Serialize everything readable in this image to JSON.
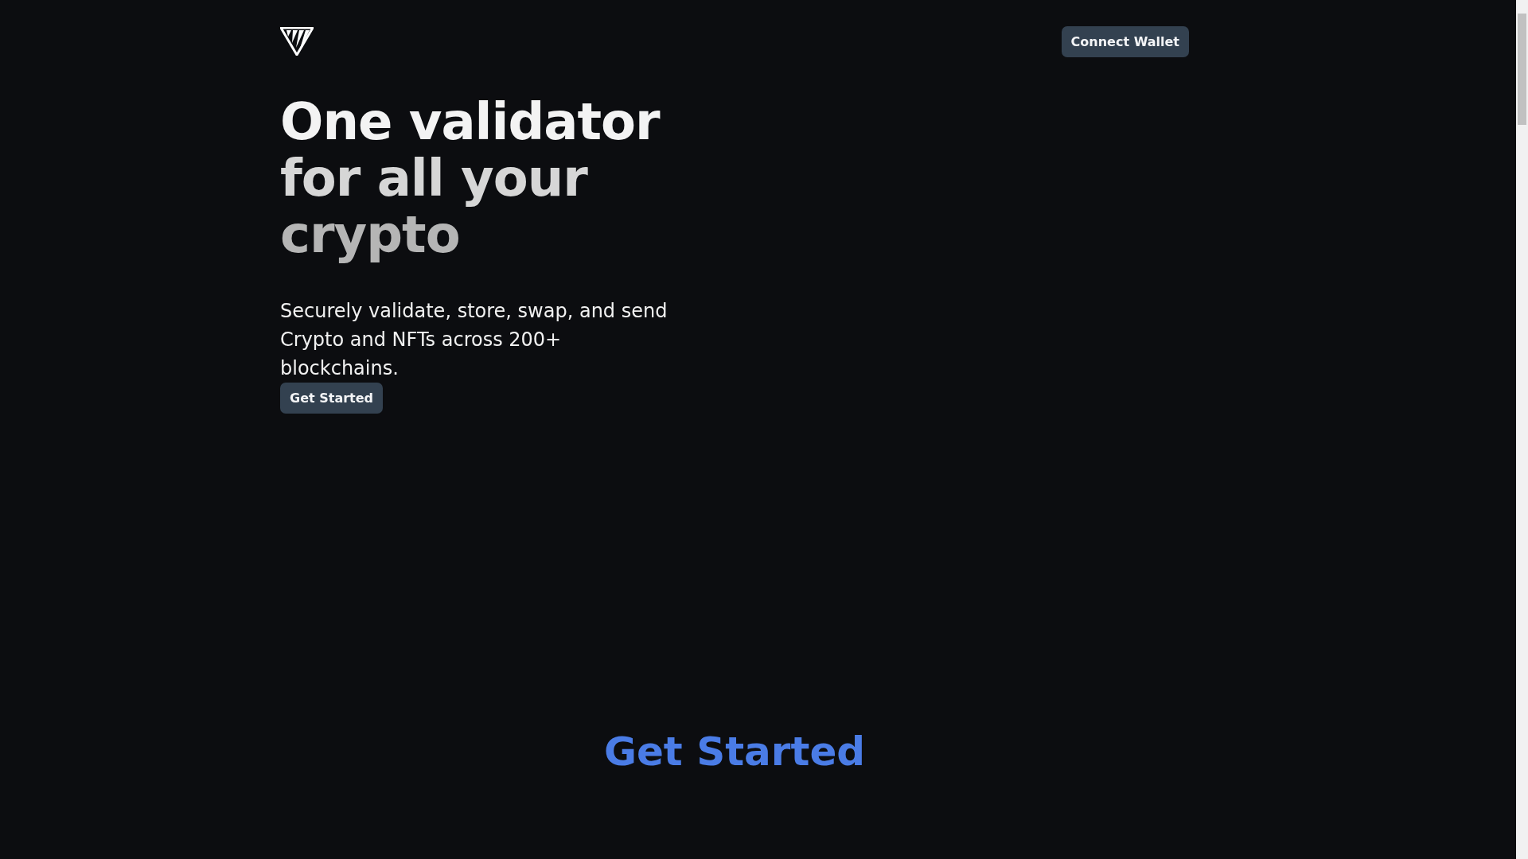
{
  "header": {
    "button": "Connect Wallet"
  },
  "hero": {
    "headline": [
      "One validator",
      "for all your",
      "crypto"
    ],
    "description": "Securely validate, store, swap, and send Crypto and NFTs across 200+ blockchains.",
    "button": "Get Started"
  },
  "section": {
    "title": "Get Started"
  }
}
